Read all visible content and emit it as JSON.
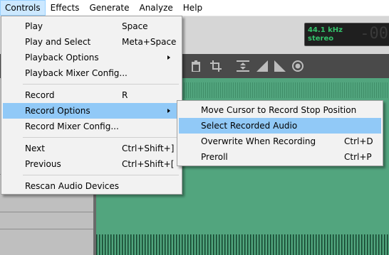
{
  "menubar": {
    "items": [
      {
        "label": "Controls"
      },
      {
        "label": "Effects"
      },
      {
        "label": "Generate"
      },
      {
        "label": "Analyze"
      },
      {
        "label": "Help"
      }
    ]
  },
  "rate": {
    "line1": "44.1 kHz",
    "line2": "stereo",
    "digits": "-00"
  },
  "controls_menu": {
    "items": [
      {
        "label": "Play",
        "accel": "Space"
      },
      {
        "label": "Play and Select",
        "accel": "Meta+Space"
      },
      {
        "label": "Playback Options",
        "accel": ""
      },
      {
        "label": "Playback Mixer Config...",
        "accel": ""
      },
      {
        "label": "Record",
        "accel": "R"
      },
      {
        "label": "Record Options",
        "accel": ""
      },
      {
        "label": "Record Mixer Config...",
        "accel": ""
      },
      {
        "label": "Next",
        "accel": "Ctrl+Shift+]"
      },
      {
        "label": "Previous",
        "accel": "Ctrl+Shift+["
      },
      {
        "label": "Rescan Audio Devices",
        "accel": ""
      }
    ]
  },
  "record_options_menu": {
    "items": [
      {
        "label": "Move Cursor to Record Stop Position",
        "accel": ""
      },
      {
        "label": "Select Recorded Audio",
        "accel": ""
      },
      {
        "label": "Overwrite When Recording",
        "accel": "Ctrl+D"
      },
      {
        "label": "Preroll",
        "accel": "Ctrl+P"
      }
    ]
  },
  "colors": {
    "highlight": "#91c9f7",
    "menubar_active": "#cce8ff",
    "track": "#52a57e",
    "rate_text": "#34c26b"
  },
  "icons": [
    "trash-icon",
    "crop-icon",
    "zoom-fit-icon",
    "fade-in-icon",
    "fade-out-icon",
    "record-meter-icon"
  ]
}
